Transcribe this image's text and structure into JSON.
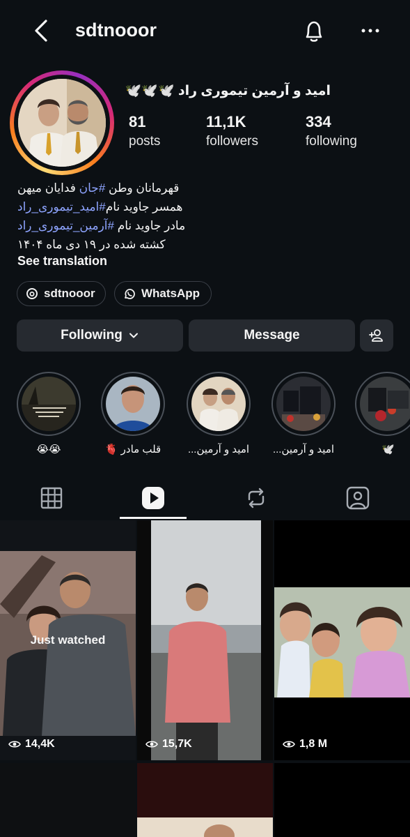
{
  "header": {
    "username": "sdtnooor",
    "icons": [
      "back-arrow-icon",
      "bell-icon",
      "more-icon"
    ]
  },
  "profile": {
    "display_name": "امید و آرمین تیموری راد 🕊️🕊️🕊️",
    "stats": [
      {
        "value": "81",
        "label": "posts"
      },
      {
        "value": "11,1K",
        "label": "followers"
      },
      {
        "value": "334",
        "label": "following"
      }
    ],
    "bio": {
      "line1_a": "قهرمانان وطن ",
      "line1_tag": "#جان",
      "line1_b": " فدایان میهن",
      "line2_a": "همسر جاوید نام",
      "line2_tag": "#امید_تیموری_راد",
      "line3_a": "مادر جاوید نام ",
      "line3_tag": "#آرمین_تیموری_راد",
      "line4": "کشته شده در ۱۹ دی ماه ۱۴۰۴"
    },
    "see_translation": "See translation",
    "links": {
      "threads": "sdtnooor",
      "whatsapp": "WhatsApp"
    }
  },
  "actions": {
    "following": "Following",
    "message": "Message"
  },
  "highlights": [
    {
      "label": "😭😭"
    },
    {
      "label": "قلب مادر 🫀"
    },
    {
      "label": "امید و آرمین..."
    },
    {
      "label": "امید و آرمین..."
    },
    {
      "label": "🕊️"
    }
  ],
  "tabs": [
    "grid-icon",
    "reels-icon",
    "reposts-icon",
    "tagged-icon"
  ],
  "reels": [
    {
      "views": "14,4K",
      "overlay": "Just watched"
    },
    {
      "views": "15,7K"
    },
    {
      "views": "1,8 M"
    }
  ],
  "colors": {
    "background": "#0c1014",
    "button": "#262a30",
    "hashtag": "#8ea4ff"
  }
}
